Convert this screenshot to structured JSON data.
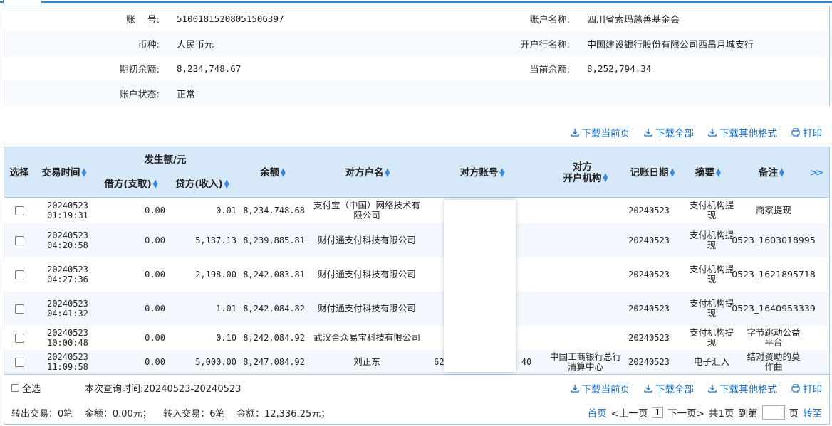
{
  "account": {
    "account_no_label": "账    号:",
    "account_no": "51001815208051506397",
    "account_name_label": "账户名称:",
    "account_name": "四川省索玛慈善基金会",
    "currency_label": "币种:",
    "currency": "人民币元",
    "bank_label": "开户行名称:",
    "bank": "中国建设银行股份有限公司西昌月城支行",
    "opening_balance_label": "期初余额:",
    "opening_balance": "8,234,748.67",
    "current_balance_label": "当前余额:",
    "current_balance": "8,252,794.34",
    "status_label": "账户状态:",
    "status": "正常"
  },
  "actions": {
    "download_page": "下载当前页",
    "download_all": "下载全部",
    "download_other": "下载其他格式",
    "print": "打印"
  },
  "table": {
    "headers": {
      "select": "选择",
      "time": "交易时间",
      "amount_group": "发生额/元",
      "debit": "借方(支取)",
      "credit": "贷方(收入)",
      "balance": "余额",
      "cp_name": "对方户名",
      "cp_account": "对方账号",
      "cp_bank_line1": "对方",
      "cp_bank_line2": "开户机构",
      "post_date": "记账日期",
      "summary": "摘要",
      "remark": "备注",
      "more": ">>"
    },
    "rows": [
      {
        "date": "20240523",
        "time": "01:19:31",
        "debit": "0.00",
        "credit": "0.01",
        "balance": "8,234,748.68",
        "cp_name": "支付宝（中国）网络技术有限公司",
        "cp_account": "",
        "cp_bank": "",
        "post_date": "20240523",
        "summary": "支付机构提现",
        "remark": "商家提现"
      },
      {
        "date": "20240523",
        "time": "04:20:58",
        "debit": "0.00",
        "credit": "5,137.13",
        "balance": "8,239,885.81",
        "cp_name": "财付通支付科技有限公司",
        "cp_account": "",
        "cp_bank": "",
        "post_date": "20240523",
        "summary": "支付机构提现",
        "remark": "0523_1603018995"
      },
      {
        "date": "20240523",
        "time": "04:27:36",
        "debit": "0.00",
        "credit": "2,198.00",
        "balance": "8,242,083.81",
        "cp_name": "财付通支付科技有限公司",
        "cp_account": "",
        "cp_bank": "",
        "post_date": "20240523",
        "summary": "支付机构提现",
        "remark": "0523_1621895718"
      },
      {
        "date": "20240523",
        "time": "04:41:32",
        "debit": "0.00",
        "credit": "1.01",
        "balance": "8,242,084.82",
        "cp_name": "财付通支付科技有限公司",
        "cp_account": "",
        "cp_bank": "",
        "post_date": "20240523",
        "summary": "支付机构提现",
        "remark": "0523_1640953339"
      },
      {
        "date": "20240523",
        "time": "10:00:48",
        "debit": "0.00",
        "credit": "0.10",
        "balance": "8,242,084.92",
        "cp_name": "武汉合众易宝科技有限公司",
        "cp_account": "",
        "cp_bank": "",
        "post_date": "20240523",
        "summary": "支付机构提现",
        "remark": "字节跳动公益平台"
      },
      {
        "date": "20240523",
        "time": "11:09:58",
        "debit": "0.00",
        "credit": "5,000.00",
        "balance": "8,247,084.92",
        "cp_name": "刘正东",
        "cp_account": "622",
        "cp_account_tail": "40",
        "cp_bank": "中国工商银行总行清算中心",
        "post_date": "20240523",
        "summary": "电子汇入",
        "remark": "结对资助的莫作曲"
      }
    ]
  },
  "footer": {
    "select_all": "全选",
    "query_time": "本次查询时间:20240523-20240523",
    "stats": "转出交易：0笔    金额：0.00元；    转入交易：6笔    金额：12,336.25元；",
    "first": "首页",
    "prev": "<上一页",
    "current": "1",
    "next": "下一页>",
    "total": "共1页",
    "goto": "到第",
    "page_unit": "页",
    "go": "转至"
  }
}
